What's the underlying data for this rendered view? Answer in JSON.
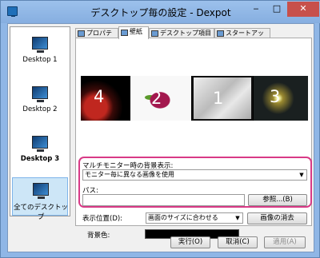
{
  "window": {
    "title": "デスクトップ毎の設定 - Dexpot",
    "controls": {
      "minimize": "‒",
      "maximize": "□",
      "close": "✕"
    }
  },
  "sidebar": {
    "items": [
      {
        "label": "Desktop 1"
      },
      {
        "label": "Desktop 2"
      },
      {
        "label": "Desktop 3"
      },
      {
        "label": "全てのデスクトップ"
      }
    ]
  },
  "tabs": [
    {
      "label": "プロパティ"
    },
    {
      "label": "壁紙"
    },
    {
      "label": "デスクトップ項目"
    },
    {
      "label": "スタートアップ"
    }
  ],
  "wallpapers": [
    {
      "number": "4"
    },
    {
      "number": "2"
    },
    {
      "number": "1"
    },
    {
      "number": "3"
    }
  ],
  "multi_monitor": {
    "label": "マルチモニター時の背景表示:",
    "selected": "モニター毎に異なる画像を使用"
  },
  "path": {
    "label": "パス:",
    "value": "",
    "browse_label": "参照...(B)"
  },
  "display_position": {
    "label": "表示位置(D):",
    "selected": "画面のサイズに合わせる",
    "clear_label": "画像の消去"
  },
  "background_color": {
    "label": "背景色:",
    "color": "#000000"
  },
  "footer": {
    "ok_label": "実行(O)",
    "cancel_label": "取消(C)",
    "apply_label": "適用(A)"
  }
}
